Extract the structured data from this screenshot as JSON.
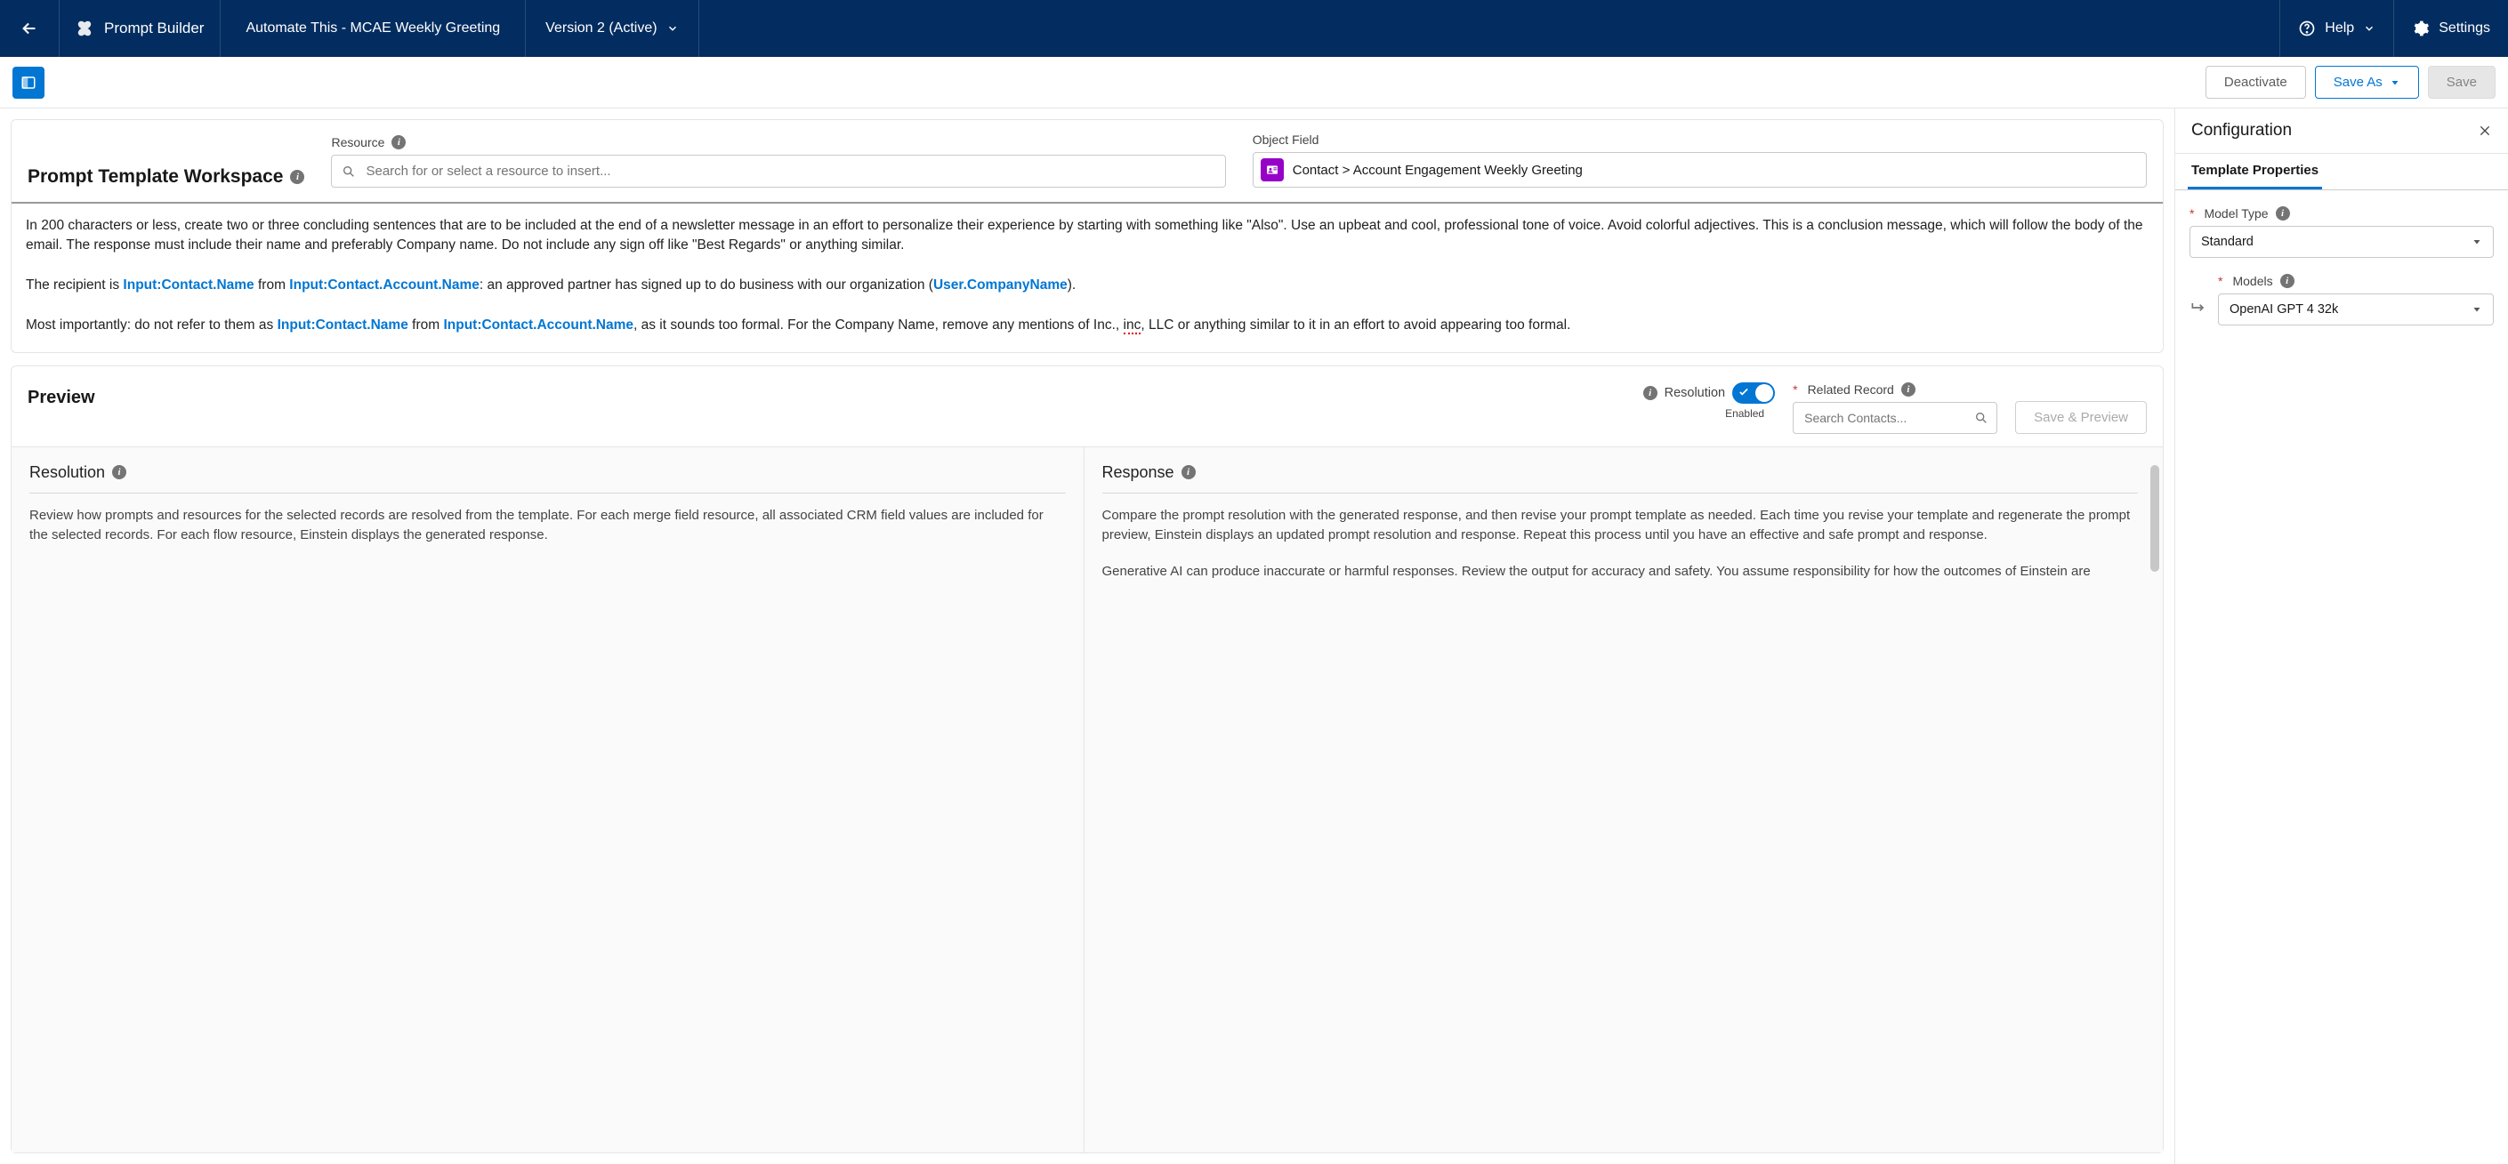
{
  "header": {
    "app_name": "Prompt Builder",
    "record_title": "Automate This - MCAE Weekly Greeting",
    "version_label": "Version 2 (Active)",
    "help_label": "Help",
    "settings_label": "Settings"
  },
  "toolbar": {
    "deactivate": "Deactivate",
    "save_as": "Save As",
    "save": "Save"
  },
  "workspace": {
    "title": "Prompt Template Workspace",
    "resource_label": "Resource",
    "resource_placeholder": "Search for or select a resource to insert...",
    "object_field_label": "Object Field",
    "object_field_value": "Contact > Account Engagement Weekly Greeting"
  },
  "prompt": {
    "p1": "In 200 characters or less, create two or three concluding sentences that are to be included at the end of a newsletter message in an effort to personalize their experience by starting with something like \"Also\". Use an upbeat and cool, professional tone of voice. Avoid colorful adjectives. This is a conclusion message, which will follow the body of the email. The response must include their name and preferably Company name. Do not include any sign off like \"Best Regards\" or anything similar.",
    "p2_a": "The recipient is ",
    "merge_contact_name": "Input:Contact.Name",
    "p2_b": " from ",
    "merge_account_name": "Input:Contact.Account.Name",
    "p2_c": ": an approved partner has signed up to do business with our organization (",
    "merge_usercompany": "User.CompanyName",
    "p2_d": ").",
    "p3_a": "Most importantly: do not refer to them as ",
    "p3_b": " from ",
    "p3_c": ", as it sounds too formal. For the Company Name, remove any mentions of Inc., ",
    "p3_inc": "inc",
    "p3_d": ", LLC or anything similar to it in an effort to avoid appearing too formal."
  },
  "preview": {
    "title": "Preview",
    "resolution_label": "Resolution",
    "toggle_state": "Enabled",
    "related_record_label": "Related Record",
    "related_record_placeholder": "Search Contacts...",
    "save_and_preview": "Save & Preview",
    "resolution_heading": "Resolution",
    "resolution_body": "Review how prompts and resources for the selected records are resolved from the template. For each merge field resource, all associated CRM field values are included for the selected records. For each flow resource, Einstein displays the generated response.",
    "response_heading": "Response",
    "response_body1": "Compare the prompt resolution with the generated response, and then revise your prompt template as needed. Each time you revise your template and regenerate the prompt preview, Einstein displays an updated prompt resolution and response. Repeat this process until you have an effective and safe prompt and response.",
    "response_body2": "Generative AI can produce inaccurate or harmful responses. Review the output for accuracy and safety. You assume responsibility for how the outcomes of Einstein are"
  },
  "config": {
    "title": "Configuration",
    "tab1": "Template Properties",
    "model_type_label": "Model Type",
    "model_type_value": "Standard",
    "models_label": "Models",
    "models_value": "OpenAI GPT 4 32k"
  }
}
